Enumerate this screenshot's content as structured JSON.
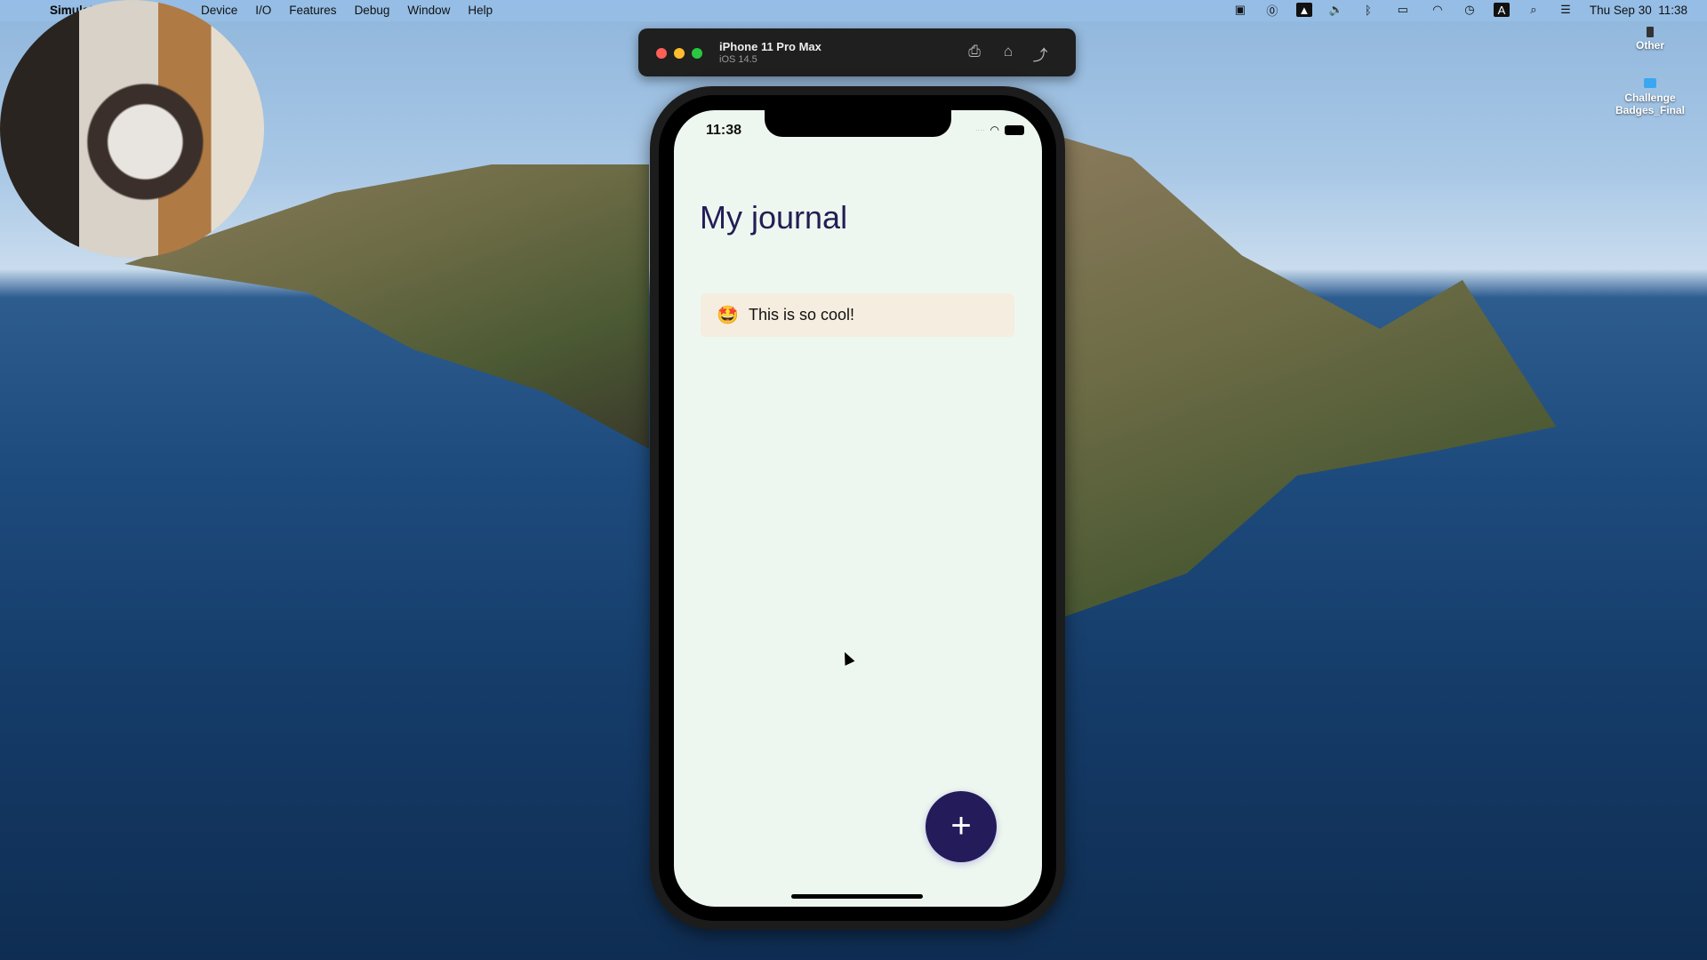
{
  "menubar": {
    "app": "Simulator",
    "app_visible": "Sim",
    "items": [
      "Device",
      "I/O",
      "Features",
      "Debug",
      "Window",
      "Help"
    ],
    "datetime": "Thu Sep 30  11:38",
    "status_icons": [
      "screen-record-icon",
      "onepassword-icon",
      "drive-icon",
      "volume-icon",
      "bluetooth-icon",
      "battery-charging-icon",
      "wifi-icon",
      "time-machine-icon",
      "input-source-icon",
      "spotlight-icon",
      "control-center-icon"
    ],
    "input_source": "A"
  },
  "desktop": {
    "items": [
      {
        "label": "Other",
        "icon": "drive-icon"
      },
      {
        "label": "Challenge Badges_Final",
        "icon": "folder-icon"
      }
    ]
  },
  "simulator": {
    "device": "iPhone 11 Pro Max",
    "os": "iOS 14.5",
    "toolbar_icons": [
      "screenshot-icon",
      "home-icon",
      "rotate-icon"
    ]
  },
  "app": {
    "status_time": "11:38",
    "title": "My journal",
    "entries": [
      {
        "emoji": "🤩",
        "text": "This is so cool!"
      }
    ],
    "add_label": "+",
    "colors": {
      "title": "#231d56",
      "fab": "#241b5a",
      "card": "#f5ede0",
      "background": "#eef7ef"
    }
  }
}
